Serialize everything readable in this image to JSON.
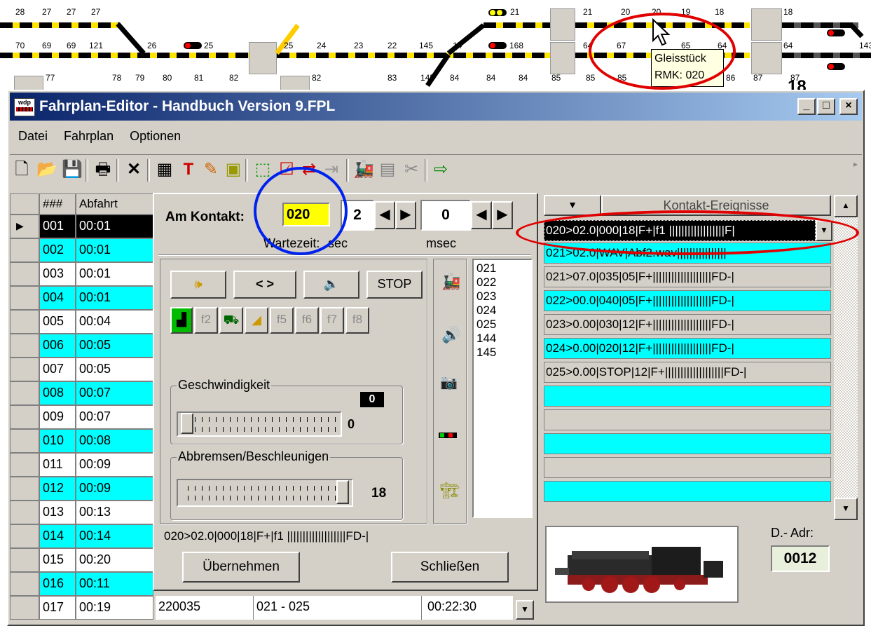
{
  "track": {
    "numbers_row1": [
      "28",
      "27",
      "27",
      "27",
      "21",
      "21",
      "20",
      "20",
      "19",
      "18",
      "18"
    ],
    "numbers_row2": [
      "70",
      "69",
      "69",
      "121",
      "26",
      "25",
      "25",
      "24",
      "23",
      "22",
      "145",
      "14",
      "168",
      "64",
      "67",
      "65",
      "64",
      "64",
      "143"
    ],
    "numbers_row3": [
      "77",
      "78",
      "79",
      "80",
      "81",
      "82",
      "82",
      "83",
      "145",
      "84",
      "84",
      "84",
      "85",
      "85",
      "85",
      "86",
      "87",
      "87"
    ],
    "big_label": "18",
    "tooltip": {
      "line1": "Gleisstück",
      "line2": "RMK: 020"
    }
  },
  "window": {
    "title": "Fahrplan-Editor - Handbuch Version 9.FPL",
    "minimize": "_",
    "maximize": "□",
    "close": "×"
  },
  "menu": [
    "Datei",
    "Fahrplan",
    "Optionen"
  ],
  "grid": {
    "header": {
      "num": "###",
      "col": "Abfahrt"
    },
    "rows": [
      {
        "num": "001",
        "time": "00:01"
      },
      {
        "num": "002",
        "time": "00:01"
      },
      {
        "num": "003",
        "time": "00:01"
      },
      {
        "num": "004",
        "time": "00:01"
      },
      {
        "num": "005",
        "time": "00:04"
      },
      {
        "num": "006",
        "time": "00:05"
      },
      {
        "num": "007",
        "time": "00:05"
      },
      {
        "num": "008",
        "time": "00:07"
      },
      {
        "num": "009",
        "time": "00:07"
      },
      {
        "num": "010",
        "time": "00:08"
      },
      {
        "num": "011",
        "time": "00:09"
      },
      {
        "num": "012",
        "time": "00:09"
      },
      {
        "num": "013",
        "time": "00:13"
      },
      {
        "num": "014",
        "time": "00:14"
      },
      {
        "num": "015",
        "time": "00:20"
      },
      {
        "num": "016",
        "time": "00:11"
      },
      {
        "num": "017",
        "time": "00:19"
      }
    ],
    "last_row_extra": {
      "c1": "220035",
      "c2": "021 - 025",
      "c3": "00:22:30"
    }
  },
  "panel": {
    "am_kontakt_label": "Am Kontakt:",
    "kontakt_value": "020",
    "wait_sec": "2",
    "wait_msec": "0",
    "wartezeit_label": "Wartezeit:",
    "sec_label": "sec",
    "msec_label": "msec",
    "btn_arrows": "< >",
    "btn_stop": "STOP",
    "f_buttons": [
      "f2",
      "f5",
      "f6",
      "f7",
      "f8"
    ],
    "contacts": [
      "021",
      "022",
      "023",
      "024",
      "025",
      "144",
      "145"
    ],
    "speed_label": "Geschwindigkeit",
    "speed_value": "0",
    "speed_display": "0",
    "brake_label": "Abbremsen/Beschleunigen",
    "brake_value": "18",
    "brake_level": 1.0,
    "speed_level": 0.0,
    "summary": "020>02.0|000|18|F+|f1 |||||||||||||||||||FD-|",
    "accept_button": "Übernehmen",
    "close_button": "Schließen"
  },
  "events": {
    "header": "Kontakt-Ereignisse",
    "selected": "020>02.0|000|18|F+|f1 ||||||||||||||||||F|",
    "rows": [
      "021>02.0|WAV|Abf2.wav||||||||||||||||",
      "021>07.0|035|05|F+|||||||||||||||||||FD-|",
      "022>00.0|040|05|F+|||||||||||||||||||FD-|",
      "023>0.00|030|12|F+|||||||||||||||||||FD-|",
      "024>0.00|020|12|F+|||||||||||||||||||FD-|",
      "025>0.00|STOP|12|F+|||||||||||||||||||FD-|",
      "",
      "",
      "",
      "",
      ""
    ]
  },
  "loco": {
    "addr_label": "D.- Adr:",
    "addr_value": "0012"
  },
  "colors": {
    "cyan": "#00ffff",
    "yellow": "#ffff00",
    "title_start": "#0a246a",
    "title_end": "#a6caf0",
    "red_ellipse": "#e00000",
    "blue_ellipse": "#0022ee"
  }
}
